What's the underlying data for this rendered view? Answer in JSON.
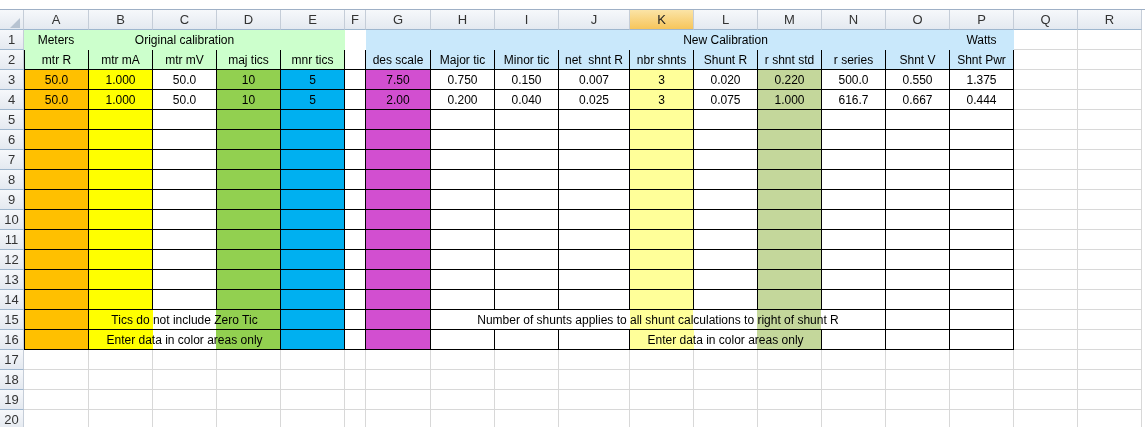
{
  "sheet": {
    "columns": [
      {
        "label": "A",
        "selected": false,
        "heading": {
          "color": "#ccffcc"
        },
        "color": "#ffc000"
      },
      {
        "label": "B",
        "selected": false,
        "heading": {
          "color": "#ccffcc"
        },
        "color": "#ffff00"
      },
      {
        "label": "C",
        "selected": false,
        "heading": {
          "color": "#ccffcc"
        }
      },
      {
        "label": "D",
        "selected": false,
        "heading": {
          "color": "#ccffcc"
        },
        "color": "#92d050"
      },
      {
        "label": "E",
        "selected": false,
        "heading": {
          "color": "#ccffcc"
        },
        "color": "#00b0f0"
      },
      {
        "label": "F",
        "selected": false
      },
      {
        "label": "G",
        "selected": false,
        "heading": {
          "color": "#c9e8fb"
        },
        "color": "#d24fd0"
      },
      {
        "label": "H",
        "selected": false,
        "heading": {
          "color": "#c9e8fb"
        }
      },
      {
        "label": "I",
        "selected": false,
        "heading": {
          "color": "#c9e8fb"
        }
      },
      {
        "label": "J",
        "selected": false,
        "heading": {
          "color": "#c9e8fb"
        }
      },
      {
        "label": "K",
        "selected": true,
        "heading": {
          "color": "#c9e8fb"
        },
        "color": "#ffff99"
      },
      {
        "label": "L",
        "selected": false,
        "heading": {
          "color": "#c9e8fb"
        }
      },
      {
        "label": "M",
        "selected": false,
        "heading": {
          "color": "#c9e8fb"
        },
        "color": "#c4d79b"
      },
      {
        "label": "N",
        "selected": false,
        "heading": {
          "color": "#c9e8fb"
        }
      },
      {
        "label": "O",
        "selected": false,
        "heading": {
          "color": "#c9e8fb"
        }
      },
      {
        "label": "P",
        "selected": false,
        "heading": {
          "color": "#c9e8fb"
        }
      },
      {
        "label": "Q",
        "selected": false
      },
      {
        "label": "R",
        "selected": false
      }
    ],
    "rows": [
      {
        "number": "1",
        "kind": "title",
        "cells": [
          "Meters",
          "",
          "Original calibration",
          "",
          "",
          "",
          "",
          "",
          "",
          "",
          "",
          "New Calibration",
          "",
          "",
          "",
          "Watts"
        ]
      },
      {
        "number": "2",
        "kind": "heading",
        "cells": [
          "mtr R",
          "mtr mA",
          "mtr mV",
          "maj tics",
          "mnr tics",
          "",
          "des scale",
          "Major tic",
          "Minor tic",
          "net  shnt R",
          "nbr shnts",
          "Shunt R",
          "r shnt std",
          "r series",
          "Shnt V",
          "Shnt Pwr"
        ]
      },
      {
        "number": "3",
        "kind": "data",
        "cells": [
          "50.0",
          "1.000",
          "50.0",
          "10",
          "5",
          "",
          "7.50",
          "0.750",
          "0.150",
          "0.007",
          "3",
          "0.020",
          "0.220",
          "500.0",
          "0.550",
          "1.375"
        ]
      },
      {
        "number": "4",
        "kind": "data",
        "cells": [
          "50.0",
          "1.000",
          "50.0",
          "10",
          "5",
          "",
          "2.00",
          "0.200",
          "0.040",
          "0.025",
          "3",
          "0.075",
          "1.000",
          "616.7",
          "0.667",
          "0.444"
        ]
      },
      {
        "number": "5",
        "kind": "data",
        "cells": [
          "",
          "",
          "",
          "",
          "",
          "",
          "",
          "",
          "",
          "",
          "",
          "",
          "",
          "",
          "",
          ""
        ]
      },
      {
        "number": "6",
        "kind": "data",
        "cells": [
          "",
          "",
          "",
          "",
          "",
          "",
          "",
          "",
          "",
          "",
          "",
          "",
          "",
          "",
          "",
          ""
        ]
      },
      {
        "number": "7",
        "kind": "data",
        "cells": [
          "",
          "",
          "",
          "",
          "",
          "",
          "",
          "",
          "",
          "",
          "",
          "",
          "",
          "",
          "",
          ""
        ]
      },
      {
        "number": "8",
        "kind": "data",
        "cells": [
          "",
          "",
          "",
          "",
          "",
          "",
          "",
          "",
          "",
          "",
          "",
          "",
          "",
          "",
          "",
          ""
        ]
      },
      {
        "number": "9",
        "kind": "data",
        "cells": [
          "",
          "",
          "",
          "",
          "",
          "",
          "",
          "",
          "",
          "",
          "",
          "",
          "",
          "",
          "",
          ""
        ]
      },
      {
        "number": "10",
        "kind": "data",
        "cells": [
          "",
          "",
          "",
          "",
          "",
          "",
          "",
          "",
          "",
          "",
          "",
          "",
          "",
          "",
          "",
          ""
        ]
      },
      {
        "number": "11",
        "kind": "data",
        "cells": [
          "",
          "",
          "",
          "",
          "",
          "",
          "",
          "",
          "",
          "",
          "",
          "",
          "",
          "",
          "",
          ""
        ]
      },
      {
        "number": "12",
        "kind": "data",
        "cells": [
          "",
          "",
          "",
          "",
          "",
          "",
          "",
          "",
          "",
          "",
          "",
          "",
          "",
          "",
          "",
          ""
        ]
      },
      {
        "number": "13",
        "kind": "data",
        "cells": [
          "",
          "",
          "",
          "",
          "",
          "",
          "",
          "",
          "",
          "",
          "",
          "",
          "",
          "",
          "",
          ""
        ]
      },
      {
        "number": "14",
        "kind": "data",
        "cells": [
          "",
          "",
          "",
          "",
          "",
          "",
          "",
          "",
          "",
          "",
          "",
          "",
          "",
          "",
          "",
          ""
        ]
      },
      {
        "number": "15",
        "kind": "data",
        "cells": [
          "",
          "",
          "Tics do not include Zero Tic",
          "",
          "",
          "",
          "",
          "",
          "",
          "",
          "Number of shunts applies to all shunt calculations to right of shunt R",
          "",
          "",
          "",
          "",
          ""
        ]
      },
      {
        "number": "16",
        "kind": "data",
        "cells": [
          "",
          "",
          "Enter data in color areas only",
          "",
          "",
          "",
          "",
          "",
          "",
          "",
          "",
          "Enter data in color areas only",
          "",
          "",
          "",
          ""
        ]
      },
      {
        "number": "17",
        "kind": "blank",
        "cells": []
      },
      {
        "number": "18",
        "kind": "blank",
        "cells": []
      },
      {
        "number": "19",
        "kind": "blank",
        "cells": []
      },
      {
        "number": "20",
        "kind": "blank",
        "cells": []
      }
    ]
  }
}
